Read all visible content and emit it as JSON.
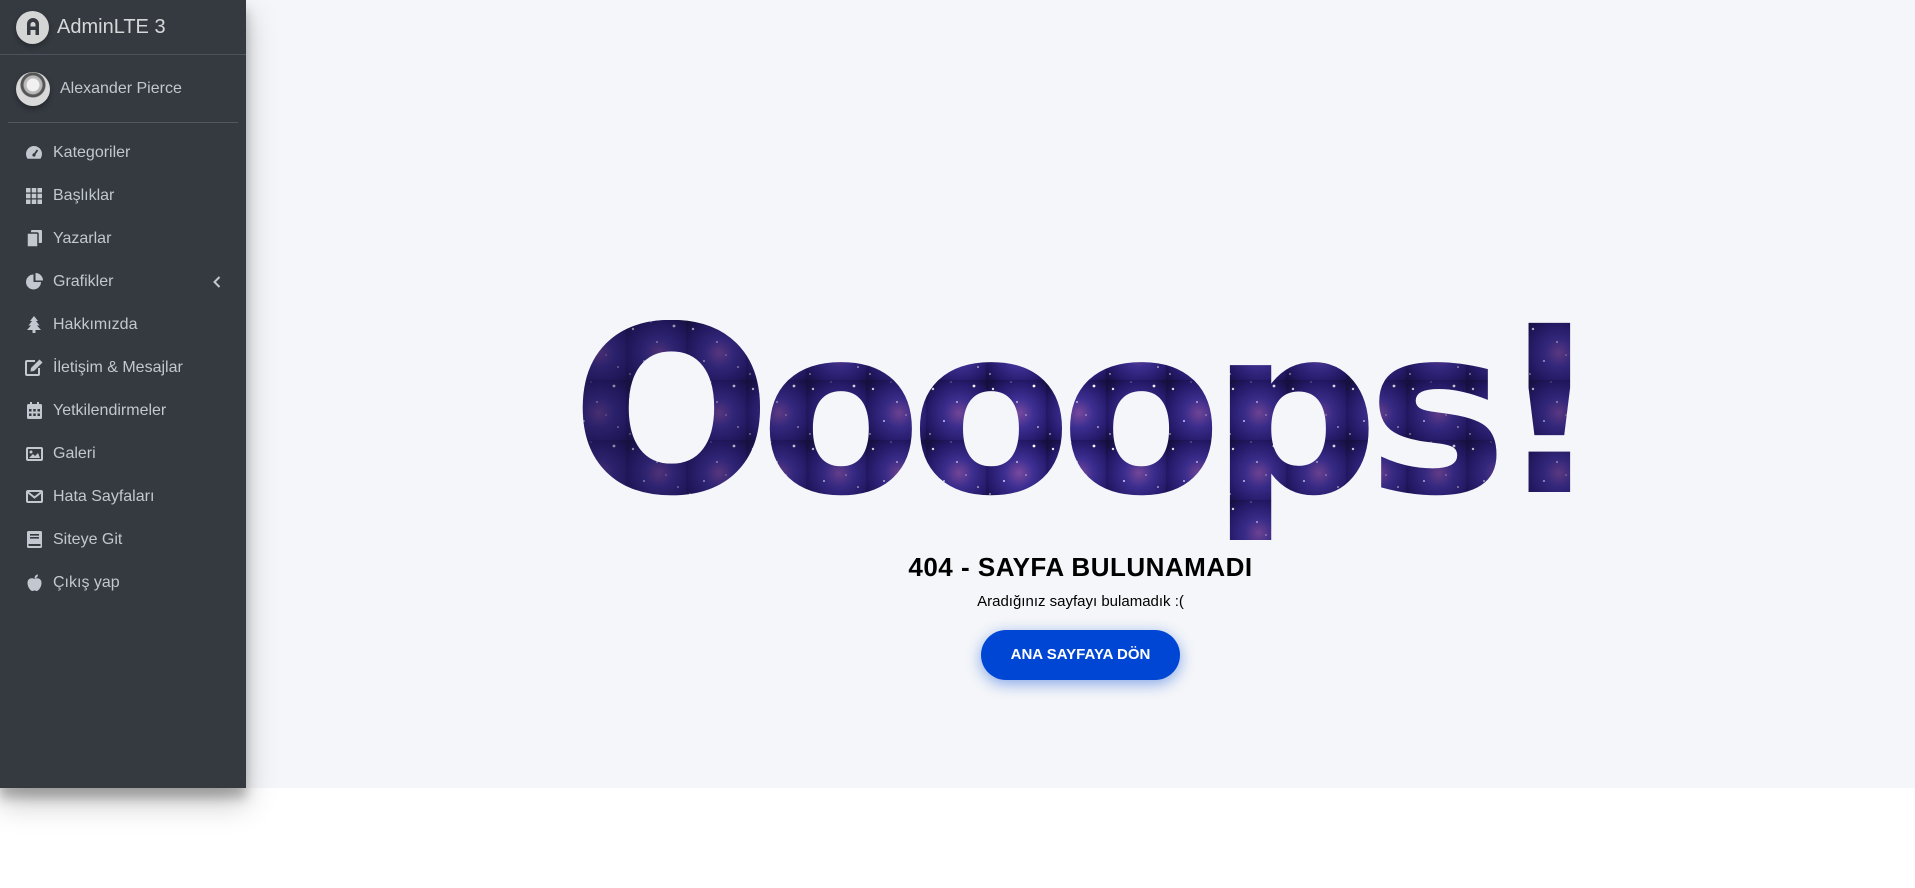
{
  "brand": {
    "name": "AdminLTE 3"
  },
  "user": {
    "name": "Alexander Pierce"
  },
  "sidebar": {
    "items": [
      {
        "label": "Kategoriler",
        "icon": "tachometer-icon"
      },
      {
        "label": "Başlıklar",
        "icon": "grid-icon"
      },
      {
        "label": "Yazarlar",
        "icon": "copy-icon"
      },
      {
        "label": "Grafikler",
        "icon": "pie-chart-icon",
        "has_submenu": true
      },
      {
        "label": "Hakkımızda",
        "icon": "tree-icon"
      },
      {
        "label": "İletişim & Mesajlar",
        "icon": "edit-icon"
      },
      {
        "label": "Yetkilendirmeler",
        "icon": "calendar-icon"
      },
      {
        "label": "Galeri",
        "icon": "image-icon"
      },
      {
        "label": "Hata Sayfaları",
        "icon": "envelope-icon"
      },
      {
        "label": "Siteye Git",
        "icon": "book-icon"
      },
      {
        "label": "Çıkış yap",
        "icon": "apple-icon"
      }
    ]
  },
  "error_page": {
    "headline": "Oooops!",
    "title": "404 - SAYFA BULUNAMADI",
    "message": "Aradığınız sayfayı bulamadık :(",
    "button_label": "ANA SAYFAYA DÖN"
  },
  "colors": {
    "sidebar_bg": "#343a40",
    "content_bg": "#f4f6f9",
    "button": "#0046d5",
    "galaxy_dark": "#1a1446",
    "galaxy_mid": "#3b2a8a"
  }
}
